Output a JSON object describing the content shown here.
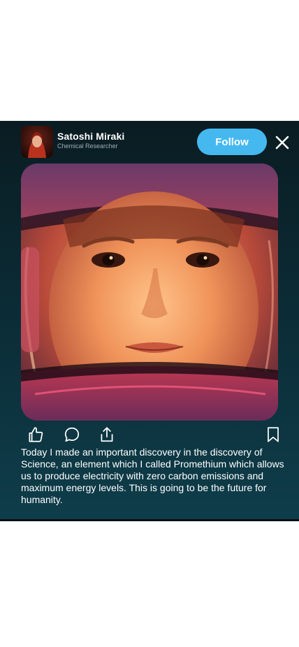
{
  "post": {
    "author": {
      "name": "Satoshi Miraki",
      "role": "Chemical Researcher",
      "avatar_icon": "profile-photo"
    },
    "follow_label": "Follow",
    "close_icon": "close-icon",
    "image_description_icon": "photo",
    "actions": {
      "like_icon": "thumbs-up-icon",
      "comment_icon": "comment-icon",
      "share_icon": "share-icon",
      "bookmark_icon": "bookmark-icon"
    },
    "caption": "Today I made an important discovery in the discovery of Science, an element which I called Promethium which allows us to produce electricity with zero carbon emissions and maximum energy levels. This is going to be the future for humanity."
  },
  "colors": {
    "card_top": "#0a1c22",
    "card_bottom": "#0e3d4a",
    "follow_button": "#45b8f0",
    "text": "#ffffff",
    "secondary_text": "#9fb0b5"
  }
}
